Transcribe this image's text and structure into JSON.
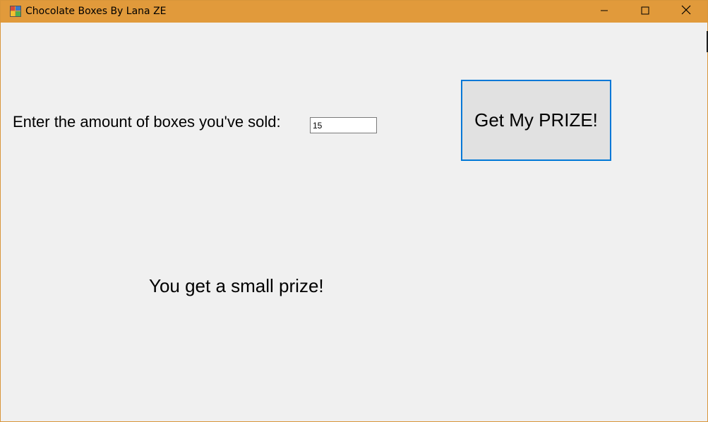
{
  "window": {
    "title": "Chocolate Boxes By Lana ZE",
    "title_bar_color": "#e19a3b"
  },
  "form": {
    "prompt_label": "Enter the amount of boxes you've sold:",
    "amount_value": "15",
    "button_label": "Get My PRIZE!",
    "result_text": "You get a small prize!",
    "button_border_color": "#0078d7"
  },
  "icons": {
    "app": "app-icon",
    "minimize": "minimize-icon",
    "maximize": "maximize-icon",
    "close": "close-icon"
  }
}
